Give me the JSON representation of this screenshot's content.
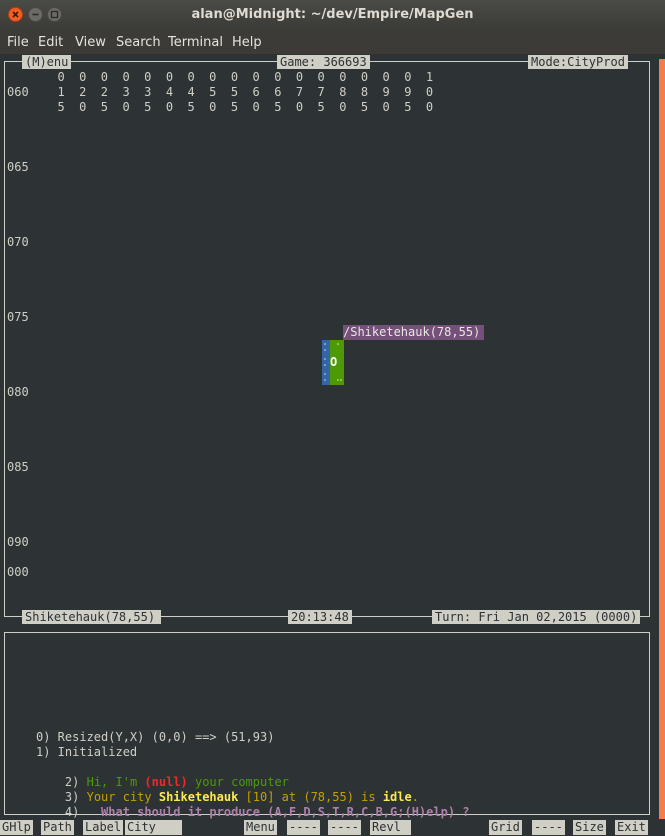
{
  "window": {
    "title": "alan@Midnight: ~/dev/Empire/MapGen"
  },
  "menubar": {
    "items": [
      "File",
      "Edit",
      "View",
      "Search",
      "Terminal",
      "Help"
    ]
  },
  "map": {
    "menu_label": "(M)enu",
    "game_label": "Game: 366693",
    "mode_label": "Mode:CityProd",
    "col_header_rows": [
      "  0  0  0  0  0  0  0  0  0  0  0  0  0  0  0  0  0  1",
      "  1  2  2  3  3  4  4  5  5  6  6  7  7  8  8  9  9  0",
      "  5  0  5  0  5  0  5  0  5  0  5  0  5  0  5  0  5  0"
    ],
    "row_060": "060",
    "row_labels": [
      "065",
      "070",
      "075",
      "080",
      "085",
      "090",
      "000"
    ],
    "city_tag": "/Shiketehauk(78,55)",
    "city_symbol": "O",
    "city_status": "Shiketehauk(78,55)",
    "clock": "20:13:48",
    "turn": "Turn: Fri Jan 02,2015 (0000)"
  },
  "log": {
    "line0": "0) Resized(Y,X) (0,0) ==> (51,93)",
    "line1": "1) Initialized",
    "line2": {
      "num": "2) ",
      "a": "Hi, I'm ",
      "null": "(null)",
      "b": " your computer"
    },
    "line3": {
      "num": "3) ",
      "a": "Your city ",
      "city": "Shiketehauk",
      "b": " [10] at (78,55) is ",
      "idle": "idle",
      "c": "."
    },
    "line4": {
      "num": "4) ",
      "text": "  What should it produce (A,F,D,S,T,R,C,B,G;(H)elp) ?"
    }
  },
  "fkeys": {
    "ghlp": "GHlp",
    "path": "Path",
    "label": "Label",
    "city": "City",
    "menu": "Menu",
    "blank1": "----",
    "blank2": "----",
    "revl": "Revl",
    "grid": "Grid",
    "blank3": "----",
    "size": "Size",
    "exit": "Exit"
  },
  "colors": {
    "terminal_bg": "#2d3234",
    "city_tag_bg": "#75507b",
    "land": "#4e9a06",
    "water": "#3465a4",
    "log_green": "#4e9a06",
    "log_null": "#ef2929",
    "log_yellow": "#c4a000",
    "log_bright_yellow": "#fce94f",
    "log_purple": "#ad7fa8",
    "scrollbar": "#f07e4f"
  }
}
